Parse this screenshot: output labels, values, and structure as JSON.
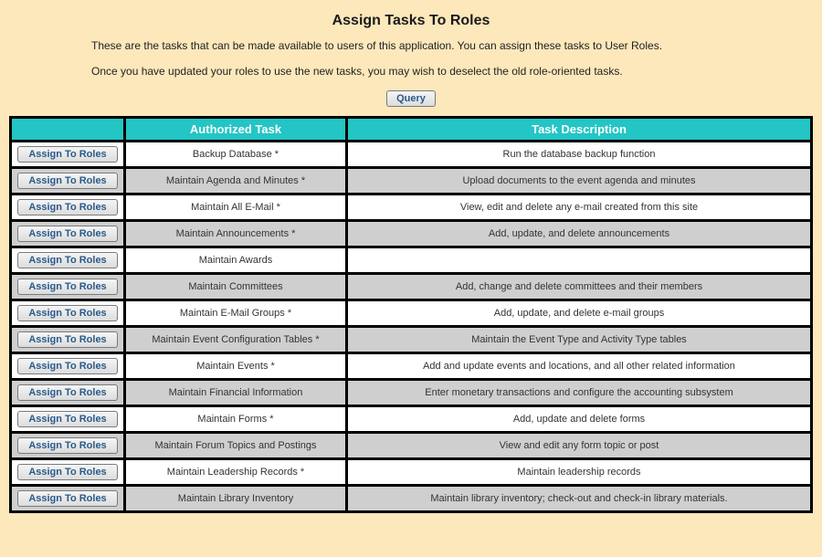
{
  "title": "Assign Tasks To Roles",
  "intro1": "These are the tasks that can be made available to users of this application. You can assign these tasks to User Roles.",
  "intro2": "Once you have updated your roles to use the new tasks, you may wish to deselect the old role-oriented tasks.",
  "query_label": "Query",
  "assign_label": "Assign To Roles",
  "columns": {
    "action": "",
    "task": "Authorized Task",
    "desc": "Task Description"
  },
  "rows": [
    {
      "task": "Backup Database *",
      "desc": "Run the database backup function"
    },
    {
      "task": "Maintain Agenda and Minutes *",
      "desc": "Upload documents to the event agenda and minutes"
    },
    {
      "task": "Maintain All E-Mail *",
      "desc": "View, edit and delete any e-mail created from this site"
    },
    {
      "task": "Maintain Announcements *",
      "desc": "Add, update, and delete announcements"
    },
    {
      "task": "Maintain Awards",
      "desc": ""
    },
    {
      "task": "Maintain Committees",
      "desc": "Add, change and delete committees and their members"
    },
    {
      "task": "Maintain E-Mail Groups *",
      "desc": "Add, update, and delete e-mail groups"
    },
    {
      "task": "Maintain Event Configuration Tables *",
      "desc": "Maintain the Event Type and Activity Type tables"
    },
    {
      "task": "Maintain Events *",
      "desc": "Add and update events and locations, and all other related information"
    },
    {
      "task": "Maintain Financial Information",
      "desc": "Enter monetary transactions and configure the accounting subsystem"
    },
    {
      "task": "Maintain Forms *",
      "desc": "Add, update and delete forms"
    },
    {
      "task": "Maintain Forum Topics and Postings",
      "desc": "View and edit any form topic or post"
    },
    {
      "task": "Maintain Leadership Records *",
      "desc": "Maintain leadership records"
    },
    {
      "task": "Maintain Library Inventory",
      "desc": "Maintain library inventory; check-out and check-in library materials."
    }
  ]
}
